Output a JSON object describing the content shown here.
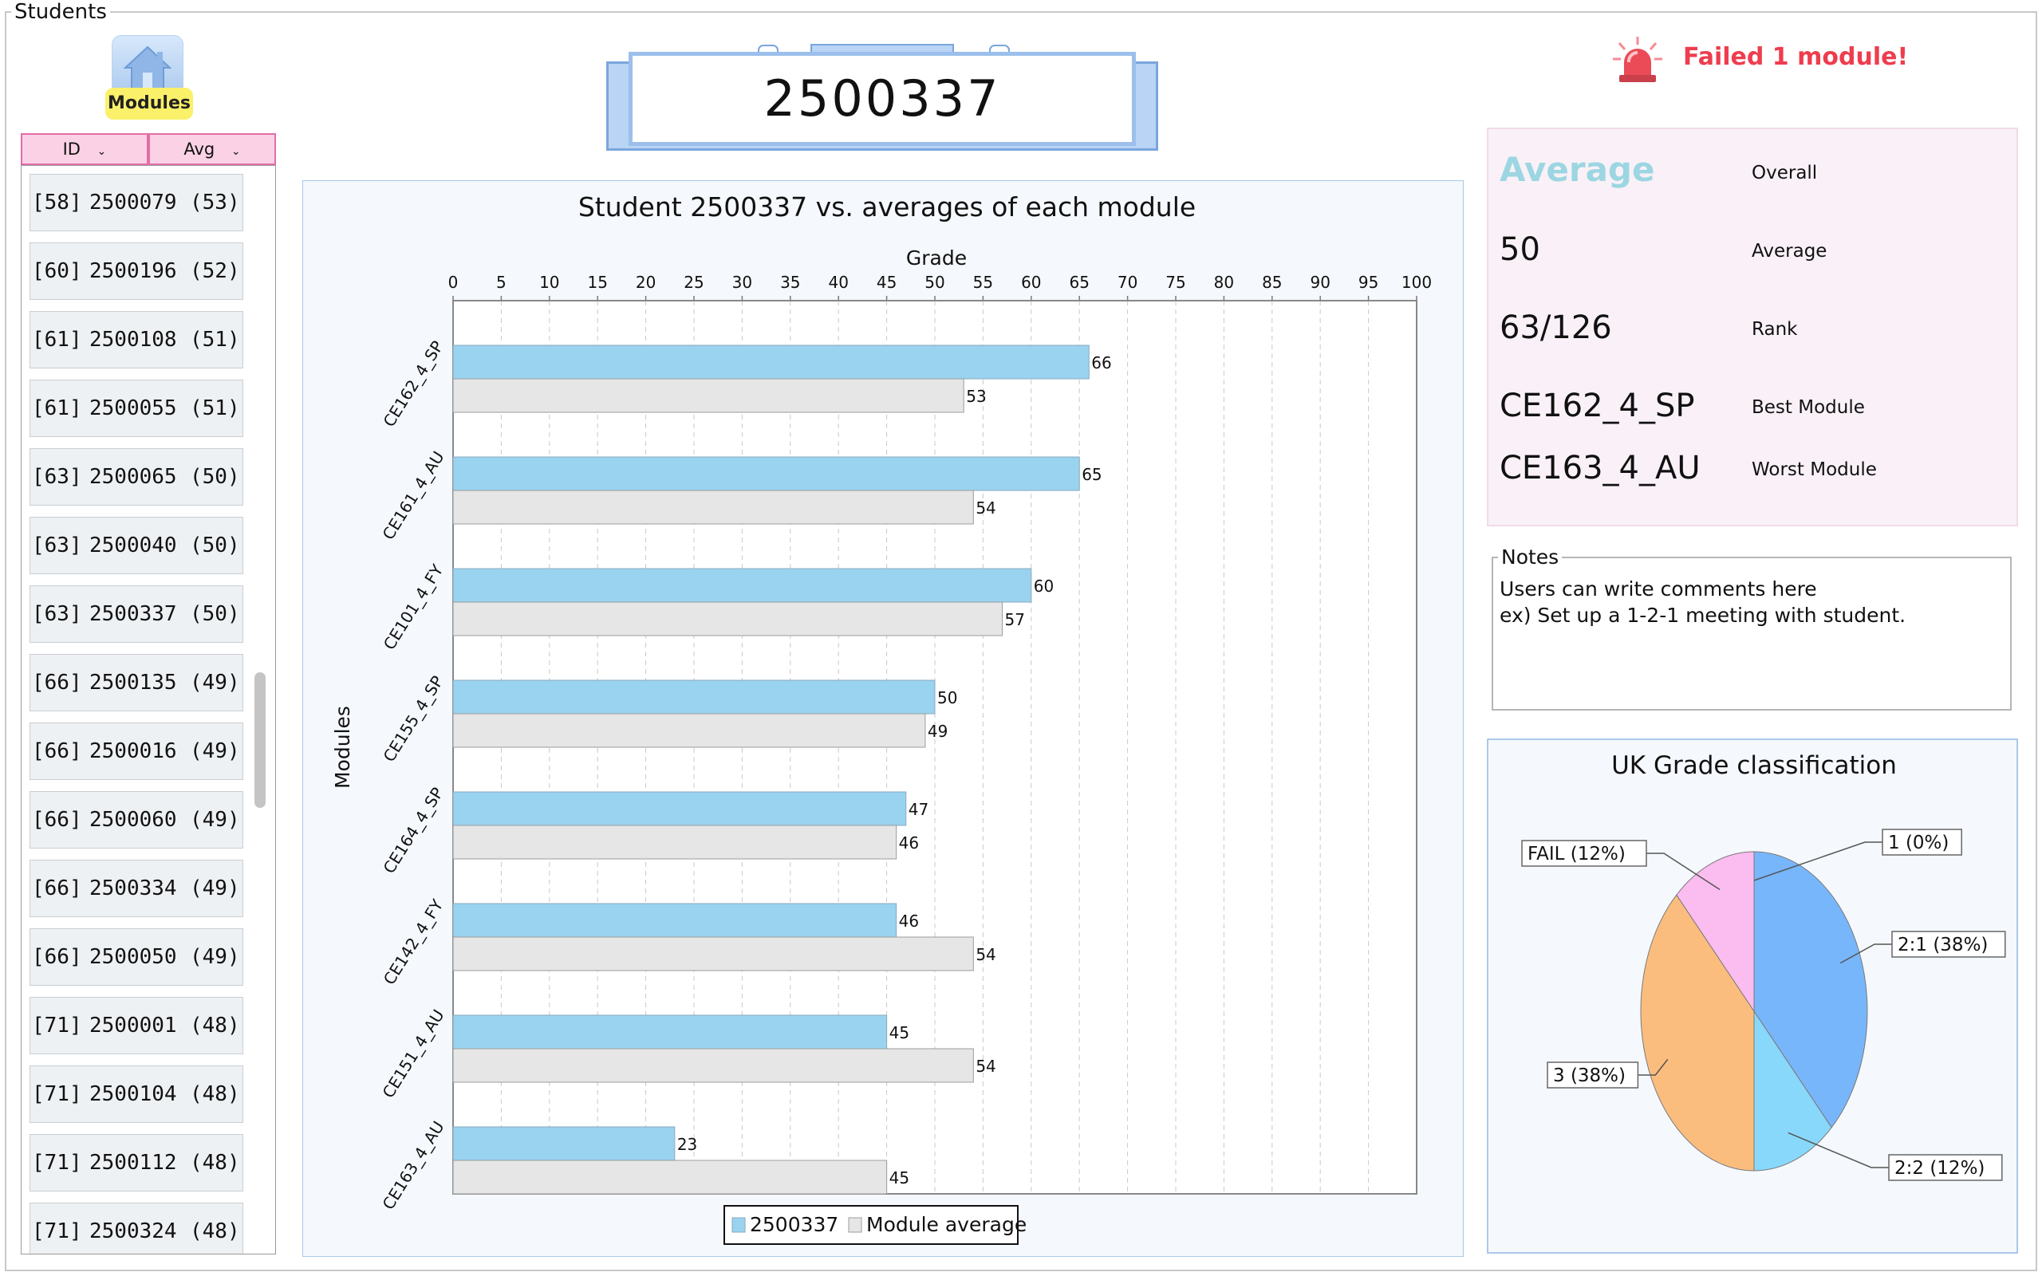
{
  "frame": {
    "title": "Students"
  },
  "modules_button": {
    "label": "Modules"
  },
  "sort_header": {
    "id_label": "ID",
    "avg_label": "Avg"
  },
  "student_list": [
    {
      "rank": "[58]",
      "id": "2500079",
      "avg": "(53)"
    },
    {
      "rank": "[60]",
      "id": "2500196",
      "avg": "(52)"
    },
    {
      "rank": "[61]",
      "id": "2500108",
      "avg": "(51)"
    },
    {
      "rank": "[61]",
      "id": "2500055",
      "avg": "(51)"
    },
    {
      "rank": "[63]",
      "id": "2500065",
      "avg": "(50)"
    },
    {
      "rank": "[63]",
      "id": "2500040",
      "avg": "(50)"
    },
    {
      "rank": "[63]",
      "id": "2500337",
      "avg": "(50)"
    },
    {
      "rank": "[66]",
      "id": "2500135",
      "avg": "(49)"
    },
    {
      "rank": "[66]",
      "id": "2500016",
      "avg": "(49)"
    },
    {
      "rank": "[66]",
      "id": "2500060",
      "avg": "(49)"
    },
    {
      "rank": "[66]",
      "id": "2500334",
      "avg": "(49)"
    },
    {
      "rank": "[66]",
      "id": "2500050",
      "avg": "(49)"
    },
    {
      "rank": "[71]",
      "id": "2500001",
      "avg": "(48)"
    },
    {
      "rank": "[71]",
      "id": "2500104",
      "avg": "(48)"
    },
    {
      "rank": "[71]",
      "id": "2500112",
      "avg": "(48)"
    },
    {
      "rank": "[71]",
      "id": "2500324",
      "avg": "(48)"
    }
  ],
  "student_id": "2500337",
  "alert": {
    "text": "Failed 1 module!",
    "icon": "alarm-siren-icon",
    "color": "#ee3d4e"
  },
  "stats": {
    "header_value": "Average",
    "header_label": "Overall",
    "average_value": "50",
    "average_label": "Average",
    "rank_value": "63/126",
    "rank_label": "Rank",
    "best_value": "CE162_4_SP",
    "best_label": "Best Module",
    "worst_value": "CE163_4_AU",
    "worst_label": "Worst Module"
  },
  "notes": {
    "legend": "Notes",
    "text": "Users can write comments here\nex) Set up a 1-2-1 meeting with student."
  },
  "chart_data": [
    {
      "type": "bar",
      "orientation": "horizontal",
      "title": "Student 2500337 vs. averages of each module",
      "xlabel": "Grade",
      "ylabel": "Modules",
      "xlim": [
        0,
        100
      ],
      "xticks": [
        0,
        5,
        10,
        15,
        20,
        25,
        30,
        35,
        40,
        45,
        50,
        55,
        60,
        65,
        70,
        75,
        80,
        85,
        90,
        95,
        100
      ],
      "categories": [
        "CE162_4_SP",
        "CE161_4_AU",
        "CE101_4_FY",
        "CE155_4_SP",
        "CE164_4_SP",
        "CE142_4_FY",
        "CE151_4_AU",
        "CE163_4_AU"
      ],
      "series": [
        {
          "name": "2500337",
          "values": [
            66,
            65,
            60,
            50,
            47,
            46,
            45,
            23
          ],
          "color": "#99d3f0"
        },
        {
          "name": "Module average",
          "values": [
            53,
            54,
            57,
            49,
            46,
            54,
            54,
            45
          ],
          "color": "#e6e6e6"
        }
      ],
      "legend": "bottom",
      "grid": true
    },
    {
      "type": "pie",
      "title": "UK Grade classification",
      "slices": [
        {
          "label": "1 (0%)",
          "value": 0,
          "color": "#5aa0f0"
        },
        {
          "label": "2:1 (38%)",
          "value": 38,
          "color": "#77b6fb"
        },
        {
          "label": "2:2 (12%)",
          "value": 12,
          "color": "#88d8fb"
        },
        {
          "label": "3 (38%)",
          "value": 38,
          "color": "#fbbd7e"
        },
        {
          "label": "FAIL (12%)",
          "value": 12,
          "color": "#fbbcf0"
        }
      ]
    }
  ]
}
